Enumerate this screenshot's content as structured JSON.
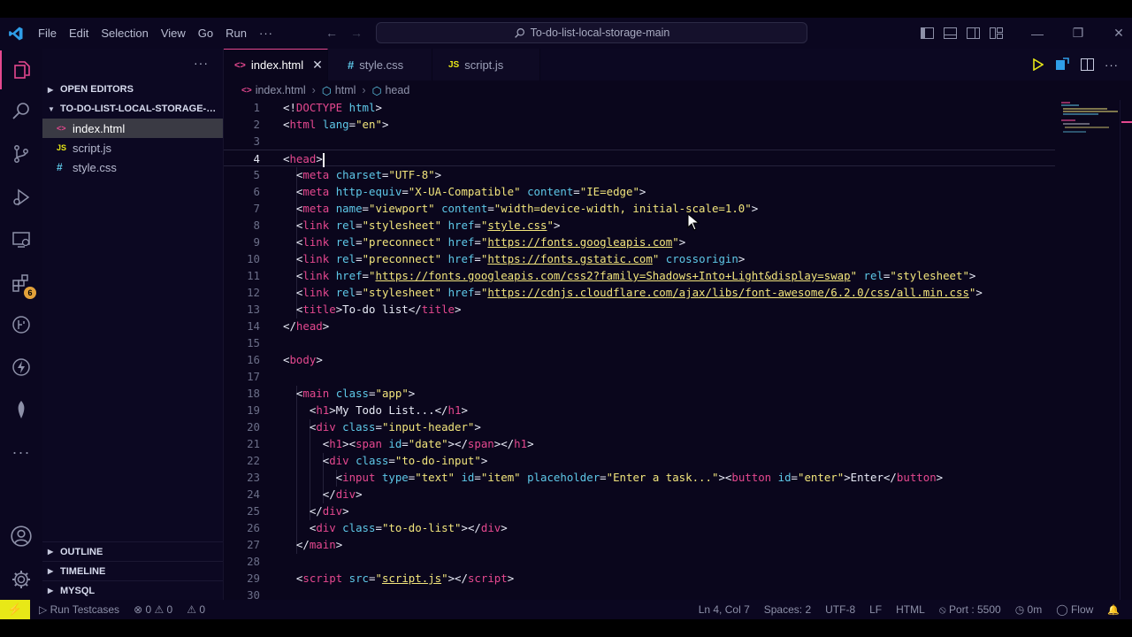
{
  "titlebar": {
    "menu": [
      "File",
      "Edit",
      "Selection",
      "View",
      "Go",
      "Run",
      "···"
    ],
    "search_text": "To-do-list-local-storage-main",
    "back_glyph": "←",
    "forward_glyph": "→",
    "minimize_glyph": "—",
    "restore_glyph": "❐",
    "close_glyph": "✕"
  },
  "activity_bar": {
    "items": [
      "explorer-icon",
      "search-icon",
      "source-control-icon",
      "run-debug-icon",
      "remote-explorer-icon",
      "extensions-icon",
      "git-graph-icon",
      "thunder-client-icon",
      "mongodb-icon",
      "more-icon"
    ],
    "extensions_badge": "6",
    "more_glyph": "···",
    "bottom": [
      "accounts-icon",
      "manage-gear-icon"
    ],
    "accent_color": "#e5488f"
  },
  "sidebar": {
    "more_glyph": "···",
    "open_editors": "OPEN EDITORS",
    "project": "TO-DO-LIST-LOCAL-STORAGE-M...",
    "files": [
      {
        "icon": "<>",
        "name": "index.html"
      },
      {
        "icon": "JS",
        "name": "script.js"
      },
      {
        "icon": "#",
        "name": "style.css"
      }
    ],
    "outline": "OUTLINE",
    "timeline": "TIMELINE",
    "mysql": "MYSQL"
  },
  "tabs": [
    {
      "icon": "<>",
      "label": "index.html",
      "close": "✕"
    },
    {
      "icon": "#",
      "label": "style.css"
    },
    {
      "icon": "JS",
      "label": "script.js"
    }
  ],
  "breadcrumb": {
    "file_icon": "<>",
    "file": "index.html",
    "html_icon": "⬡",
    "html": "html",
    "head_icon": "⬡",
    "head": "head",
    "sep": "›"
  },
  "editor": {
    "current_line": 4,
    "lines": [
      [
        [
          "p",
          "<!"
        ],
        [
          "t",
          "DOCTYPE"
        ],
        [
          "p",
          " "
        ],
        [
          "a",
          "html"
        ],
        [
          "p",
          ">"
        ]
      ],
      [
        [
          "p",
          "<"
        ],
        [
          "t",
          "html"
        ],
        [
          "p",
          " "
        ],
        [
          "a",
          "lang"
        ],
        [
          "p",
          "="
        ],
        [
          "s",
          "\"en\""
        ],
        [
          "p",
          ">"
        ]
      ],
      [],
      [
        [
          "p",
          "<"
        ],
        [
          "t",
          "head"
        ],
        [
          "p",
          ">"
        ],
        [
          "cursor",
          ""
        ]
      ],
      [
        [
          "p",
          "  <"
        ],
        [
          "t",
          "meta"
        ],
        [
          "p",
          " "
        ],
        [
          "a",
          "charset"
        ],
        [
          "p",
          "="
        ],
        [
          "s",
          "\"UTF-8\""
        ],
        [
          "p",
          ">"
        ]
      ],
      [
        [
          "p",
          "  <"
        ],
        [
          "t",
          "meta"
        ],
        [
          "p",
          " "
        ],
        [
          "a",
          "http-equiv"
        ],
        [
          "p",
          "="
        ],
        [
          "s",
          "\"X-UA-Compatible\""
        ],
        [
          "p",
          " "
        ],
        [
          "a",
          "content"
        ],
        [
          "p",
          "="
        ],
        [
          "s",
          "\"IE=edge\""
        ],
        [
          "p",
          ">"
        ]
      ],
      [
        [
          "p",
          "  <"
        ],
        [
          "t",
          "meta"
        ],
        [
          "p",
          " "
        ],
        [
          "a",
          "name"
        ],
        [
          "p",
          "="
        ],
        [
          "s",
          "\"viewport\""
        ],
        [
          "p",
          " "
        ],
        [
          "a",
          "content"
        ],
        [
          "p",
          "="
        ],
        [
          "s",
          "\"width=device-width, initial-scale=1.0\""
        ],
        [
          "p",
          ">"
        ]
      ],
      [
        [
          "p",
          "  <"
        ],
        [
          "t",
          "link"
        ],
        [
          "p",
          " "
        ],
        [
          "a",
          "rel"
        ],
        [
          "p",
          "="
        ],
        [
          "s",
          "\"stylesheet\""
        ],
        [
          "p",
          " "
        ],
        [
          "a",
          "href"
        ],
        [
          "p",
          "="
        ],
        [
          "s",
          "\""
        ],
        [
          "u",
          "style.css"
        ],
        [
          "s",
          "\""
        ],
        [
          "p",
          ">"
        ]
      ],
      [
        [
          "p",
          "  <"
        ],
        [
          "t",
          "link"
        ],
        [
          "p",
          " "
        ],
        [
          "a",
          "rel"
        ],
        [
          "p",
          "="
        ],
        [
          "s",
          "\"preconnect\""
        ],
        [
          "p",
          " "
        ],
        [
          "a",
          "href"
        ],
        [
          "p",
          "="
        ],
        [
          "s",
          "\""
        ],
        [
          "u",
          "https://fonts.googleapis.com"
        ],
        [
          "s",
          "\""
        ],
        [
          "p",
          ">"
        ]
      ],
      [
        [
          "p",
          "  <"
        ],
        [
          "t",
          "link"
        ],
        [
          "p",
          " "
        ],
        [
          "a",
          "rel"
        ],
        [
          "p",
          "="
        ],
        [
          "s",
          "\"preconnect\""
        ],
        [
          "p",
          " "
        ],
        [
          "a",
          "href"
        ],
        [
          "p",
          "="
        ],
        [
          "s",
          "\""
        ],
        [
          "u",
          "https://fonts.gstatic.com"
        ],
        [
          "s",
          "\""
        ],
        [
          "p",
          " "
        ],
        [
          "a",
          "crossorigin"
        ],
        [
          "p",
          ">"
        ]
      ],
      [
        [
          "p",
          "  <"
        ],
        [
          "t",
          "link"
        ],
        [
          "p",
          " "
        ],
        [
          "a",
          "href"
        ],
        [
          "p",
          "="
        ],
        [
          "s",
          "\""
        ],
        [
          "u",
          "https://fonts.googleapis.com/css2?family=Shadows+Into+Light&display=swap"
        ],
        [
          "s",
          "\""
        ],
        [
          "p",
          " "
        ],
        [
          "a",
          "rel"
        ],
        [
          "p",
          "="
        ],
        [
          "s",
          "\"stylesheet\""
        ],
        [
          "p",
          ">"
        ]
      ],
      [
        [
          "p",
          "  <"
        ],
        [
          "t",
          "link"
        ],
        [
          "p",
          " "
        ],
        [
          "a",
          "rel"
        ],
        [
          "p",
          "="
        ],
        [
          "s",
          "\"stylesheet\""
        ],
        [
          "p",
          " "
        ],
        [
          "a",
          "href"
        ],
        [
          "p",
          "="
        ],
        [
          "s",
          "\""
        ],
        [
          "u",
          "https://cdnjs.cloudflare.com/ajax/libs/font-awesome/6.2.0/css/all.min.css"
        ],
        [
          "s",
          "\""
        ],
        [
          "p",
          ">"
        ]
      ],
      [
        [
          "p",
          "  <"
        ],
        [
          "t",
          "title"
        ],
        [
          "p",
          ">To-do list</"
        ],
        [
          "t",
          "title"
        ],
        [
          "p",
          ">"
        ]
      ],
      [
        [
          "p",
          "</"
        ],
        [
          "t",
          "head"
        ],
        [
          "p",
          ">"
        ]
      ],
      [],
      [
        [
          "p",
          "<"
        ],
        [
          "t",
          "body"
        ],
        [
          "p",
          ">"
        ]
      ],
      [],
      [
        [
          "p",
          "  <"
        ],
        [
          "t",
          "main"
        ],
        [
          "p",
          " "
        ],
        [
          "a",
          "class"
        ],
        [
          "p",
          "="
        ],
        [
          "s",
          "\"app\""
        ],
        [
          "p",
          ">"
        ]
      ],
      [
        [
          "p",
          "    <"
        ],
        [
          "t",
          "h1"
        ],
        [
          "p",
          ">My Todo List...</"
        ],
        [
          "t",
          "h1"
        ],
        [
          "p",
          ">"
        ]
      ],
      [
        [
          "p",
          "    <"
        ],
        [
          "t",
          "div"
        ],
        [
          "p",
          " "
        ],
        [
          "a",
          "class"
        ],
        [
          "p",
          "="
        ],
        [
          "s",
          "\"input-header\""
        ],
        [
          "p",
          ">"
        ]
      ],
      [
        [
          "p",
          "      <"
        ],
        [
          "t",
          "h1"
        ],
        [
          "p",
          "><"
        ],
        [
          "t",
          "span"
        ],
        [
          "p",
          " "
        ],
        [
          "a",
          "id"
        ],
        [
          "p",
          "="
        ],
        [
          "s",
          "\"date\""
        ],
        [
          "p",
          "></"
        ],
        [
          "t",
          "span"
        ],
        [
          "p",
          "></"
        ],
        [
          "t",
          "h1"
        ],
        [
          "p",
          ">"
        ]
      ],
      [
        [
          "p",
          "      <"
        ],
        [
          "t",
          "div"
        ],
        [
          "p",
          " "
        ],
        [
          "a",
          "class"
        ],
        [
          "p",
          "="
        ],
        [
          "s",
          "\"to-do-input\""
        ],
        [
          "p",
          ">"
        ]
      ],
      [
        [
          "p",
          "        <"
        ],
        [
          "t",
          "input"
        ],
        [
          "p",
          " "
        ],
        [
          "a",
          "type"
        ],
        [
          "p",
          "="
        ],
        [
          "s",
          "\"text\""
        ],
        [
          "p",
          " "
        ],
        [
          "a",
          "id"
        ],
        [
          "p",
          "="
        ],
        [
          "s",
          "\"item\""
        ],
        [
          "p",
          " "
        ],
        [
          "a",
          "placeholder"
        ],
        [
          "p",
          "="
        ],
        [
          "s",
          "\"Enter a task...\""
        ],
        [
          "p",
          "><"
        ],
        [
          "t",
          "button"
        ],
        [
          "p",
          " "
        ],
        [
          "a",
          "id"
        ],
        [
          "p",
          "="
        ],
        [
          "s",
          "\"enter\""
        ],
        [
          "p",
          ">Enter</"
        ],
        [
          "t",
          "button"
        ],
        [
          "p",
          ">"
        ]
      ],
      [
        [
          "p",
          "      </"
        ],
        [
          "t",
          "div"
        ],
        [
          "p",
          ">"
        ]
      ],
      [
        [
          "p",
          "    </"
        ],
        [
          "t",
          "div"
        ],
        [
          "p",
          ">"
        ]
      ],
      [
        [
          "p",
          "    <"
        ],
        [
          "t",
          "div"
        ],
        [
          "p",
          " "
        ],
        [
          "a",
          "class"
        ],
        [
          "p",
          "="
        ],
        [
          "s",
          "\"to-do-list\""
        ],
        [
          "p",
          "></"
        ],
        [
          "t",
          "div"
        ],
        [
          "p",
          ">"
        ]
      ],
      [
        [
          "p",
          "  </"
        ],
        [
          "t",
          "main"
        ],
        [
          "p",
          ">"
        ]
      ],
      [],
      [
        [
          "p",
          "  <"
        ],
        [
          "t",
          "script"
        ],
        [
          "p",
          " "
        ],
        [
          "a",
          "src"
        ],
        [
          "p",
          "="
        ],
        [
          "s",
          "\""
        ],
        [
          "u",
          "script.js"
        ],
        [
          "s",
          "\""
        ],
        [
          "p",
          "></"
        ],
        [
          "t",
          "script"
        ],
        [
          "p",
          ">"
        ]
      ],
      []
    ]
  },
  "statusbar": {
    "remote_glyph": "⚡",
    "run_testcases": "Run Testcases",
    "errors": "⊗ 0 ⚠ 0",
    "ports": "⚠ 0",
    "position": "Ln 4, Col 7",
    "spaces": "Spaces: 2",
    "encoding": "UTF-8",
    "eol": "LF",
    "language": "HTML",
    "port": "Port : 5500",
    "time": "0m",
    "flow": "Flow",
    "bell_glyph": "🔔"
  }
}
